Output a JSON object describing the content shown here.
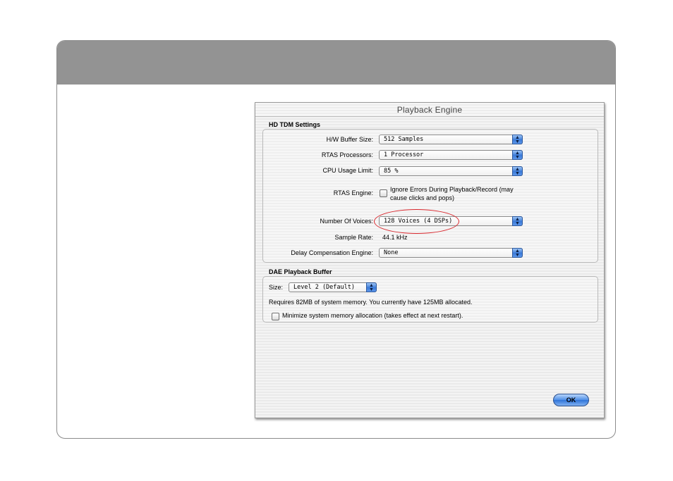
{
  "window": {
    "title": "Playback Engine"
  },
  "hd_tdm": {
    "section_label": "HD TDM Settings",
    "hw_buffer": {
      "label": "H/W Buffer Size:",
      "value": "512 Samples"
    },
    "rtas_processors": {
      "label": "RTAS Processors:",
      "value": "1 Processor"
    },
    "cpu_usage": {
      "label": "CPU Usage Limit:",
      "value": "85 %"
    },
    "rtas_engine": {
      "label": "RTAS Engine:",
      "checkbox_line1": "Ignore Errors During Playback/Record (may",
      "checkbox_line2": "cause clicks and pops)",
      "checked": false
    },
    "voices": {
      "label": "Number Of Voices:",
      "value": "128 Voices (4 DSPs)"
    },
    "sample_rate": {
      "label": "Sample Rate:",
      "value": "44.1 kHz"
    },
    "delay_comp": {
      "label": "Delay Compensation Engine:",
      "value": "None"
    }
  },
  "dae": {
    "section_label": "DAE Playback Buffer",
    "size": {
      "label": "Size:",
      "value": "Level 2 (Default)"
    },
    "memory_note": "Requires 82MB of system memory. You currently have 125MB allocated.",
    "minimize": {
      "label": "Minimize system memory allocation (takes effect at next restart).",
      "checked": false
    }
  },
  "buttons": {
    "ok": "OK"
  },
  "icons": {
    "popup_arrows": "up-down-arrows-icon"
  },
  "colors": {
    "highlight": "#d8262c",
    "header_band": "#939393",
    "accent_blue": "#3b7ad8"
  }
}
